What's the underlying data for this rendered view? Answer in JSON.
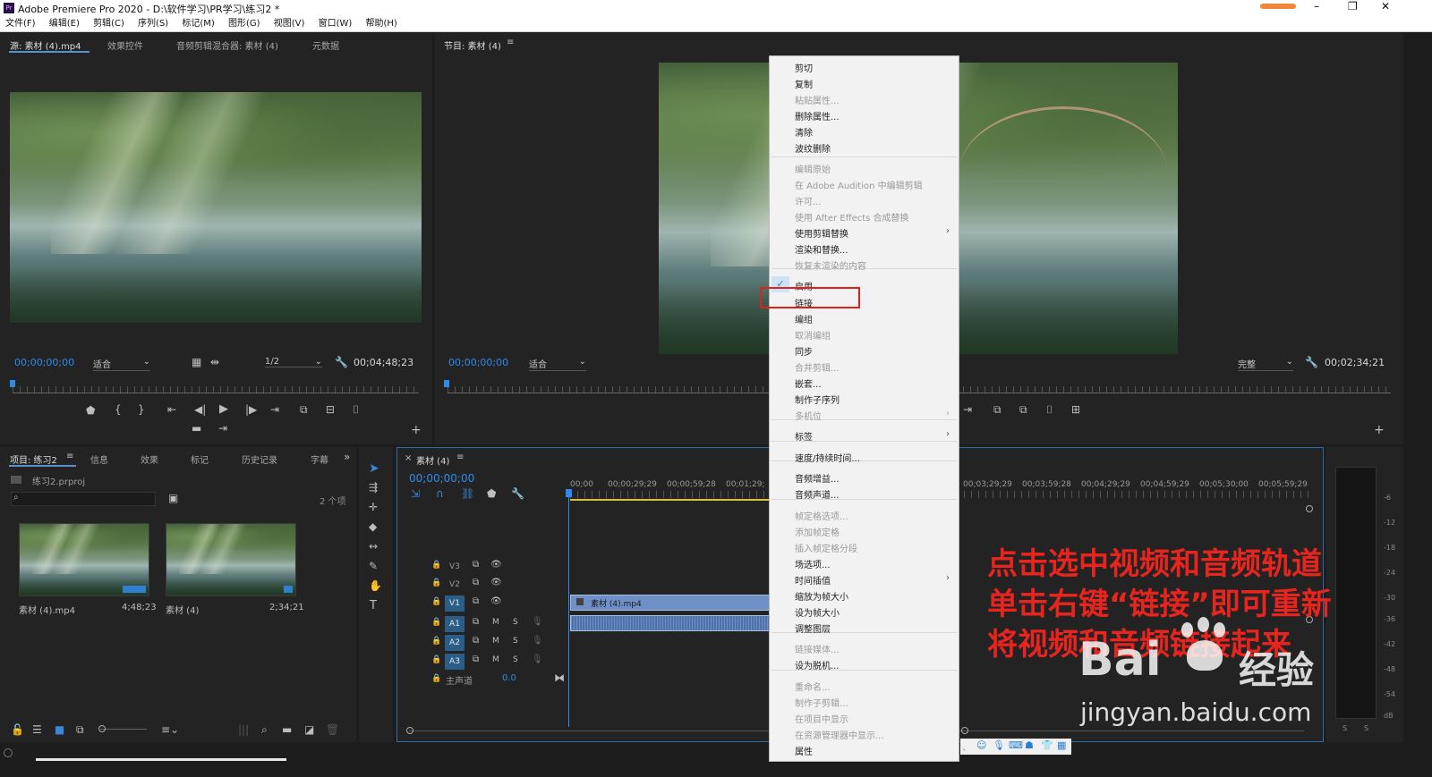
{
  "window": {
    "title": "Adobe Premiere Pro 2020 - D:\\软件学习\\PR学习\\练习2 *"
  },
  "menu": [
    "文件(F)",
    "编辑(E)",
    "剪辑(C)",
    "序列(S)",
    "标记(M)",
    "图形(G)",
    "视图(V)",
    "窗口(W)",
    "帮助(H)"
  ],
  "source_panel": {
    "tabs": [
      "源: 素材 (4).mp4",
      "效果控件",
      "音频剪辑混合器: 素材 (4)",
      "元数据"
    ],
    "timecode": "00;00;00;00",
    "fit": "适合",
    "resolution": "1/2",
    "duration": "00;04;48;23"
  },
  "program_panel": {
    "tab": "节目: 素材 (4)",
    "timecode": "00;00;00;00",
    "fit": "适合",
    "quality": "完整",
    "duration": "00;02;34;21"
  },
  "project_panel": {
    "tabs": [
      "项目: 练习2",
      "信息",
      "效果",
      "标记",
      "历史记录",
      "字幕"
    ],
    "file": "练习2.prproj",
    "count": "2 个项",
    "items": [
      {
        "name": "素材 (4).mp4",
        "duration": "4;48;23"
      },
      {
        "name": "素材 (4)",
        "duration": "2;34;21"
      }
    ]
  },
  "timeline": {
    "tab": "素材 (4)",
    "timecode": "00;00;00;00",
    "ruler": [
      "00;00",
      "00;00;29;29",
      "00;00;59;28",
      "00;01;29;",
      "00;03;29;29",
      "00;03;59;28",
      "00;04;29;29",
      "00;04;59;29",
      "00;05;30;00",
      "00;05;59;29"
    ],
    "tracks_video": [
      "V3",
      "V2",
      "V1"
    ],
    "tracks_audio": [
      "A1",
      "A2",
      "A3"
    ],
    "master": {
      "label": "主声道",
      "value": "0.0"
    },
    "clip_name": "素材 (4).mp4"
  },
  "meter_scale": [
    "-6",
    "-12",
    "-18",
    "-24",
    "-30",
    "-36",
    "-42",
    "-48",
    "-54",
    "dB"
  ],
  "meter_solo": [
    "S",
    "S"
  ],
  "context_menu": {
    "items": [
      {
        "label": "剪切",
        "disabled": false
      },
      {
        "label": "复制",
        "disabled": false
      },
      {
        "label": "粘贴属性...",
        "disabled": true
      },
      {
        "label": "删除属性...",
        "disabled": false
      },
      {
        "label": "清除",
        "disabled": false
      },
      {
        "label": "波纹删除",
        "disabled": false
      },
      {
        "label": "编辑原始",
        "disabled": true
      },
      {
        "label": "在 Adobe Audition 中编辑剪辑",
        "disabled": true
      },
      {
        "label": "许可...",
        "disabled": true
      },
      {
        "label": "使用 After Effects 合成替换",
        "disabled": true
      },
      {
        "label": "使用剪辑替换",
        "disabled": false
      },
      {
        "label": "渲染和替换...",
        "disabled": false
      },
      {
        "label": "恢复未渲染的内容",
        "disabled": true
      },
      {
        "label": "启用",
        "disabled": false
      },
      {
        "label": "链接",
        "disabled": false
      },
      {
        "label": "编组",
        "disabled": false
      },
      {
        "label": "取消编组",
        "disabled": true
      },
      {
        "label": "同步",
        "disabled": false
      },
      {
        "label": "合并剪辑...",
        "disabled": true
      },
      {
        "label": "嵌套...",
        "disabled": false
      },
      {
        "label": "制作子序列",
        "disabled": false
      },
      {
        "label": "多机位",
        "disabled": true
      },
      {
        "label": "标签",
        "disabled": false
      },
      {
        "label": "速度/持续时间...",
        "disabled": false
      },
      {
        "label": "音频增益...",
        "disabled": false
      },
      {
        "label": "音频声道...",
        "disabled": false
      },
      {
        "label": "帧定格选项...",
        "disabled": true
      },
      {
        "label": "添加帧定格",
        "disabled": true
      },
      {
        "label": "插入帧定格分段",
        "disabled": true
      },
      {
        "label": "场选项...",
        "disabled": false
      },
      {
        "label": "时间插值",
        "disabled": false
      },
      {
        "label": "缩放为帧大小",
        "disabled": false
      },
      {
        "label": "设为帧大小",
        "disabled": false
      },
      {
        "label": "调整图层",
        "disabled": false
      },
      {
        "label": "链接媒体...",
        "disabled": true
      },
      {
        "label": "设为脱机...",
        "disabled": false
      },
      {
        "label": "重命名...",
        "disabled": true
      },
      {
        "label": "制作子剪辑...",
        "disabled": true
      },
      {
        "label": "在项目中显示",
        "disabled": true
      },
      {
        "label": "在资源管理器中显示...",
        "disabled": true
      },
      {
        "label": "属性",
        "disabled": false
      }
    ]
  },
  "annotation": {
    "line1": "点击选中视频和音频轨道",
    "line2": "单击右键“链接”即可重新",
    "line3": "将视频和音频链接起来",
    "color": "#e8241f"
  },
  "watermark": {
    "brand": "Bai",
    "brand2": "经验",
    "url": "jingyan.baidu.com"
  },
  "colors": {
    "timecode_blue": "#2d8ceb",
    "highlight_red": "#e0201a",
    "track_blue": "#2a5e87"
  }
}
